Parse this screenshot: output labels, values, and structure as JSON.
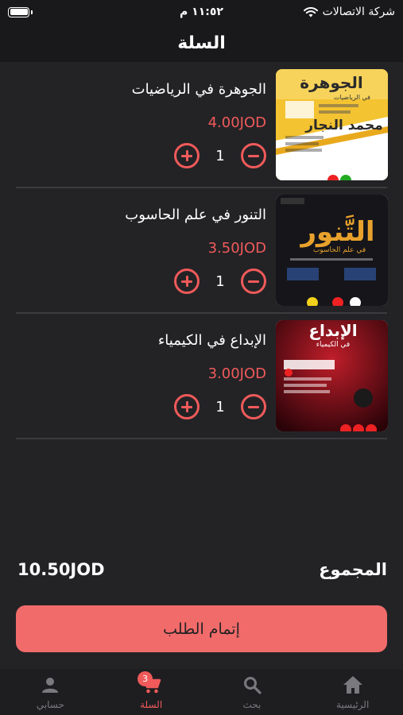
{
  "status_bar": {
    "time": "١١:٥٢ م",
    "carrier": "شركة الاتصالات"
  },
  "header": {
    "title": "السلة"
  },
  "cart": {
    "items": [
      {
        "title": "الجوهرة في الرياضيات",
        "price": "4.00JOD",
        "quantity": "1",
        "cover": {
          "top_text": "الجوهرة",
          "subtitle": "في الرياضيات",
          "author": "محمد النجار",
          "colors": [
            "#f4c331",
            "#ffffff"
          ]
        }
      },
      {
        "title": "التنور في علم الحاسوب",
        "price": "3.50JOD",
        "quantity": "1",
        "cover": {
          "top_text": "التَّنور",
          "subtitle": "في علم الحاسوب",
          "colors": [
            "#15151a",
            "#e8a22c"
          ]
        }
      },
      {
        "title": "الإبداع في الكيمياء",
        "price": "3.00JOD",
        "quantity": "1",
        "cover": {
          "top_text": "الإبداع",
          "subtitle": "في الكيمياء",
          "colors": [
            "#5a0a14",
            "#c01e2a"
          ]
        }
      }
    ],
    "total_label": "المجموع",
    "total_value": "10.50JOD",
    "checkout_label": "إتمام الطلب"
  },
  "tabbar": {
    "tabs": [
      {
        "label": "حسابي",
        "icon": "person-icon"
      },
      {
        "label": "السلة",
        "icon": "cart-icon",
        "badge": "3",
        "active": true
      },
      {
        "label": "بحث",
        "icon": "search-icon"
      },
      {
        "label": "الرئيسية",
        "icon": "home-icon"
      }
    ]
  },
  "colors": {
    "accent": "#f05a5a",
    "button": "#f26b6b",
    "background": "#232326",
    "bar": "#19191b"
  }
}
